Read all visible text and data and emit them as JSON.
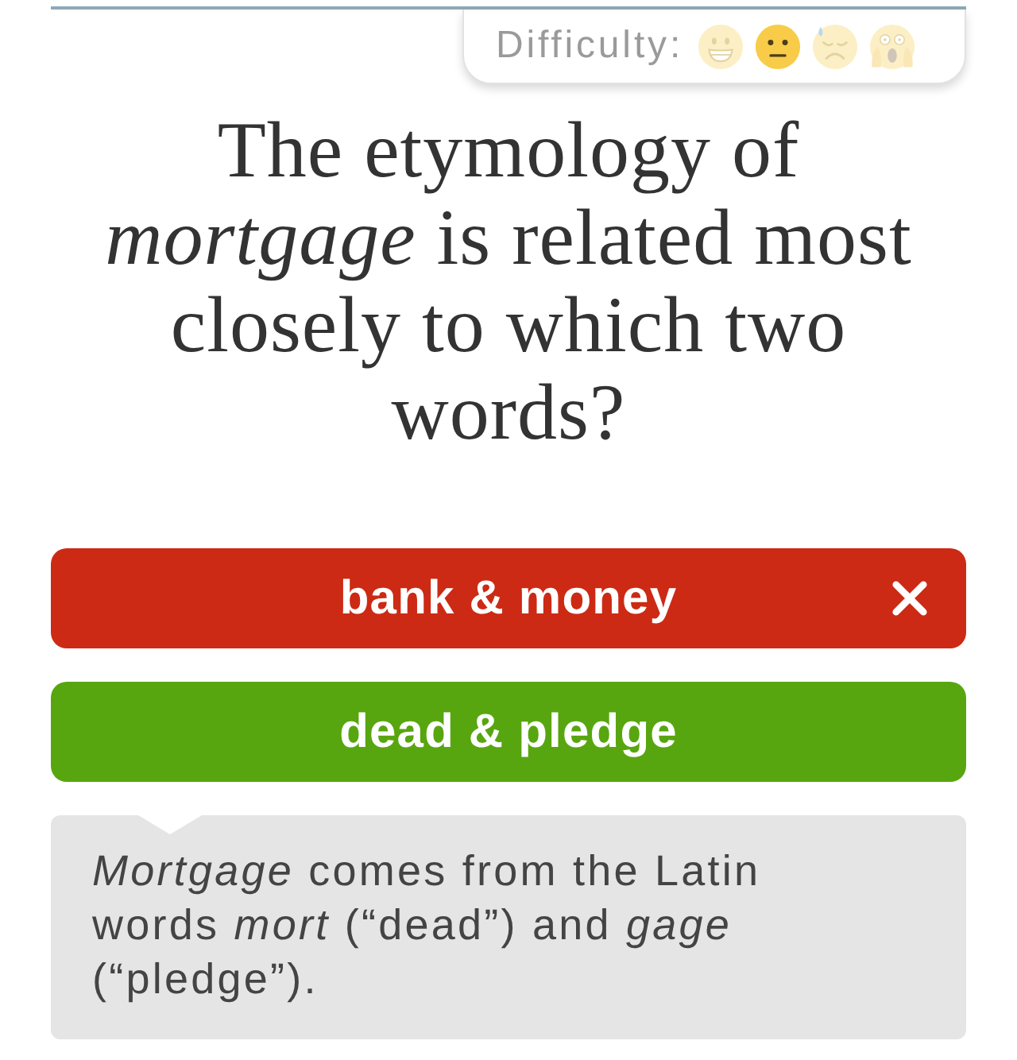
{
  "difficulty": {
    "label": "Difficulty:",
    "levels": [
      {
        "kind": "grin",
        "selected": false
      },
      {
        "kind": "neutral",
        "selected": true
      },
      {
        "kind": "sweat",
        "selected": false
      },
      {
        "kind": "scream",
        "selected": false
      }
    ]
  },
  "question": "The etymology of *mortgage* is related most closely to which two words?",
  "answers": [
    {
      "label": "bank & money",
      "selected": true,
      "correct": false
    },
    {
      "label": "dead & pledge",
      "selected": false,
      "correct": true
    }
  ],
  "explanation": "*Mortgage* comes from the Latin words *mort* (“dead”) and *gage* (“pledge”)."
}
